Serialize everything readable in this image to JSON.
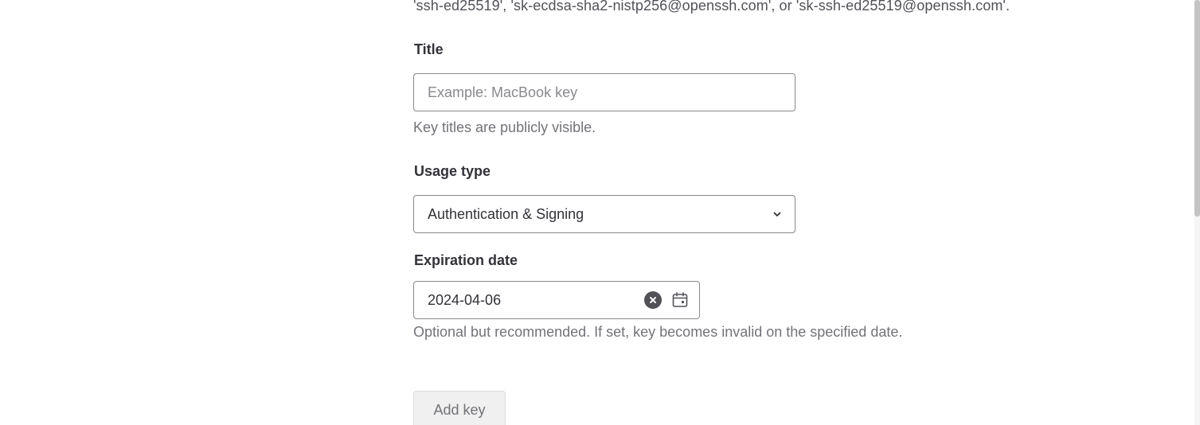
{
  "key_types_help": "'ssh-ed25519', 'sk-ecdsa-sha2-nistp256@openssh.com', or 'sk-ssh-ed25519@openssh.com'.",
  "title_field": {
    "label": "Title",
    "placeholder": "Example: MacBook key",
    "value": "",
    "help": "Key titles are publicly visible."
  },
  "usage_type": {
    "label": "Usage type",
    "selected": "Authentication & Signing",
    "icon": "chevron-down-icon"
  },
  "expiration": {
    "label": "Expiration date",
    "value": "2024-04-06",
    "help": "Optional but recommended. If set, key becomes invalid on the specified date.",
    "icons": [
      "clear-icon",
      "calendar-icon"
    ]
  },
  "submit": {
    "label": "Add key",
    "disabled": true
  },
  "colors": {
    "text": "#333238",
    "muted": "#737278",
    "border": "#89888d",
    "button_bg": "#f0f0f0"
  }
}
